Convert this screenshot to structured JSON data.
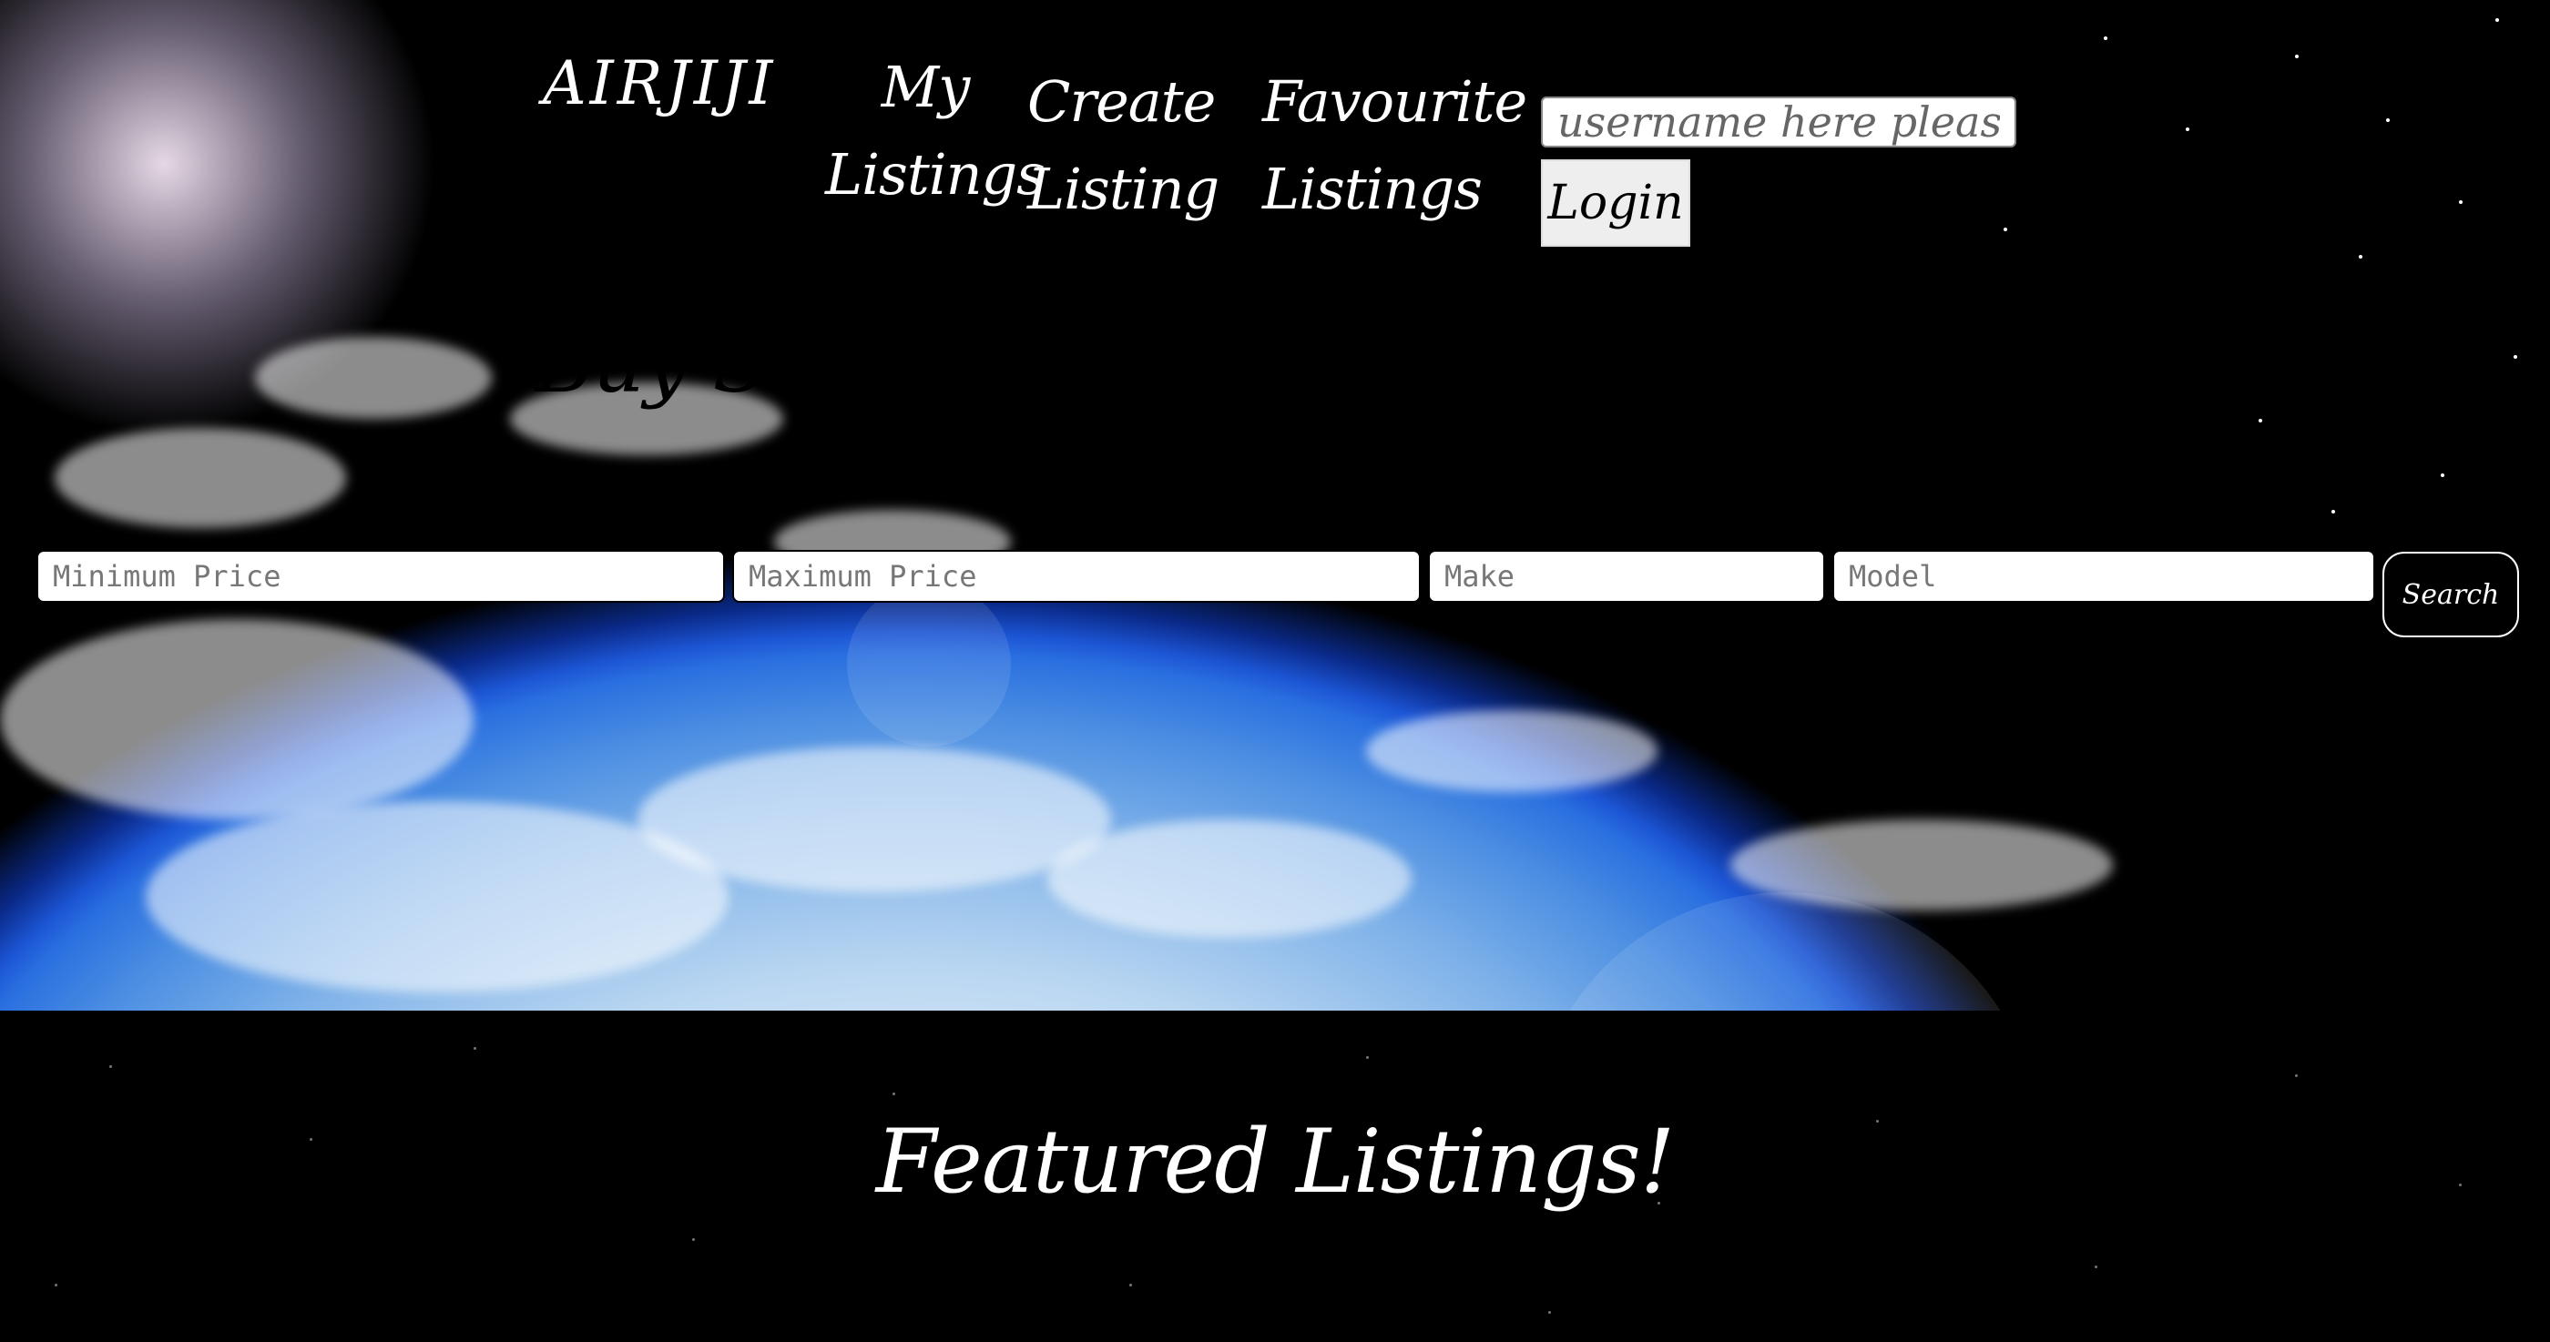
{
  "nav": {
    "brand": "AIRJIJI",
    "my_listings": "My Listings",
    "create_listing": "Create Listing",
    "favourite_listings": "Favourite Listings"
  },
  "login": {
    "username_placeholder": "username here please",
    "login_label": "Login"
  },
  "hero": {
    "title": "Buy Some Airplanes and Spaceships!"
  },
  "search": {
    "min_price_placeholder": "Minimum Price",
    "max_price_placeholder": "Maximum Price",
    "make_placeholder": "Make",
    "model_placeholder": "Model",
    "search_label": "Search"
  },
  "featured": {
    "title": "Featured Listings!"
  }
}
